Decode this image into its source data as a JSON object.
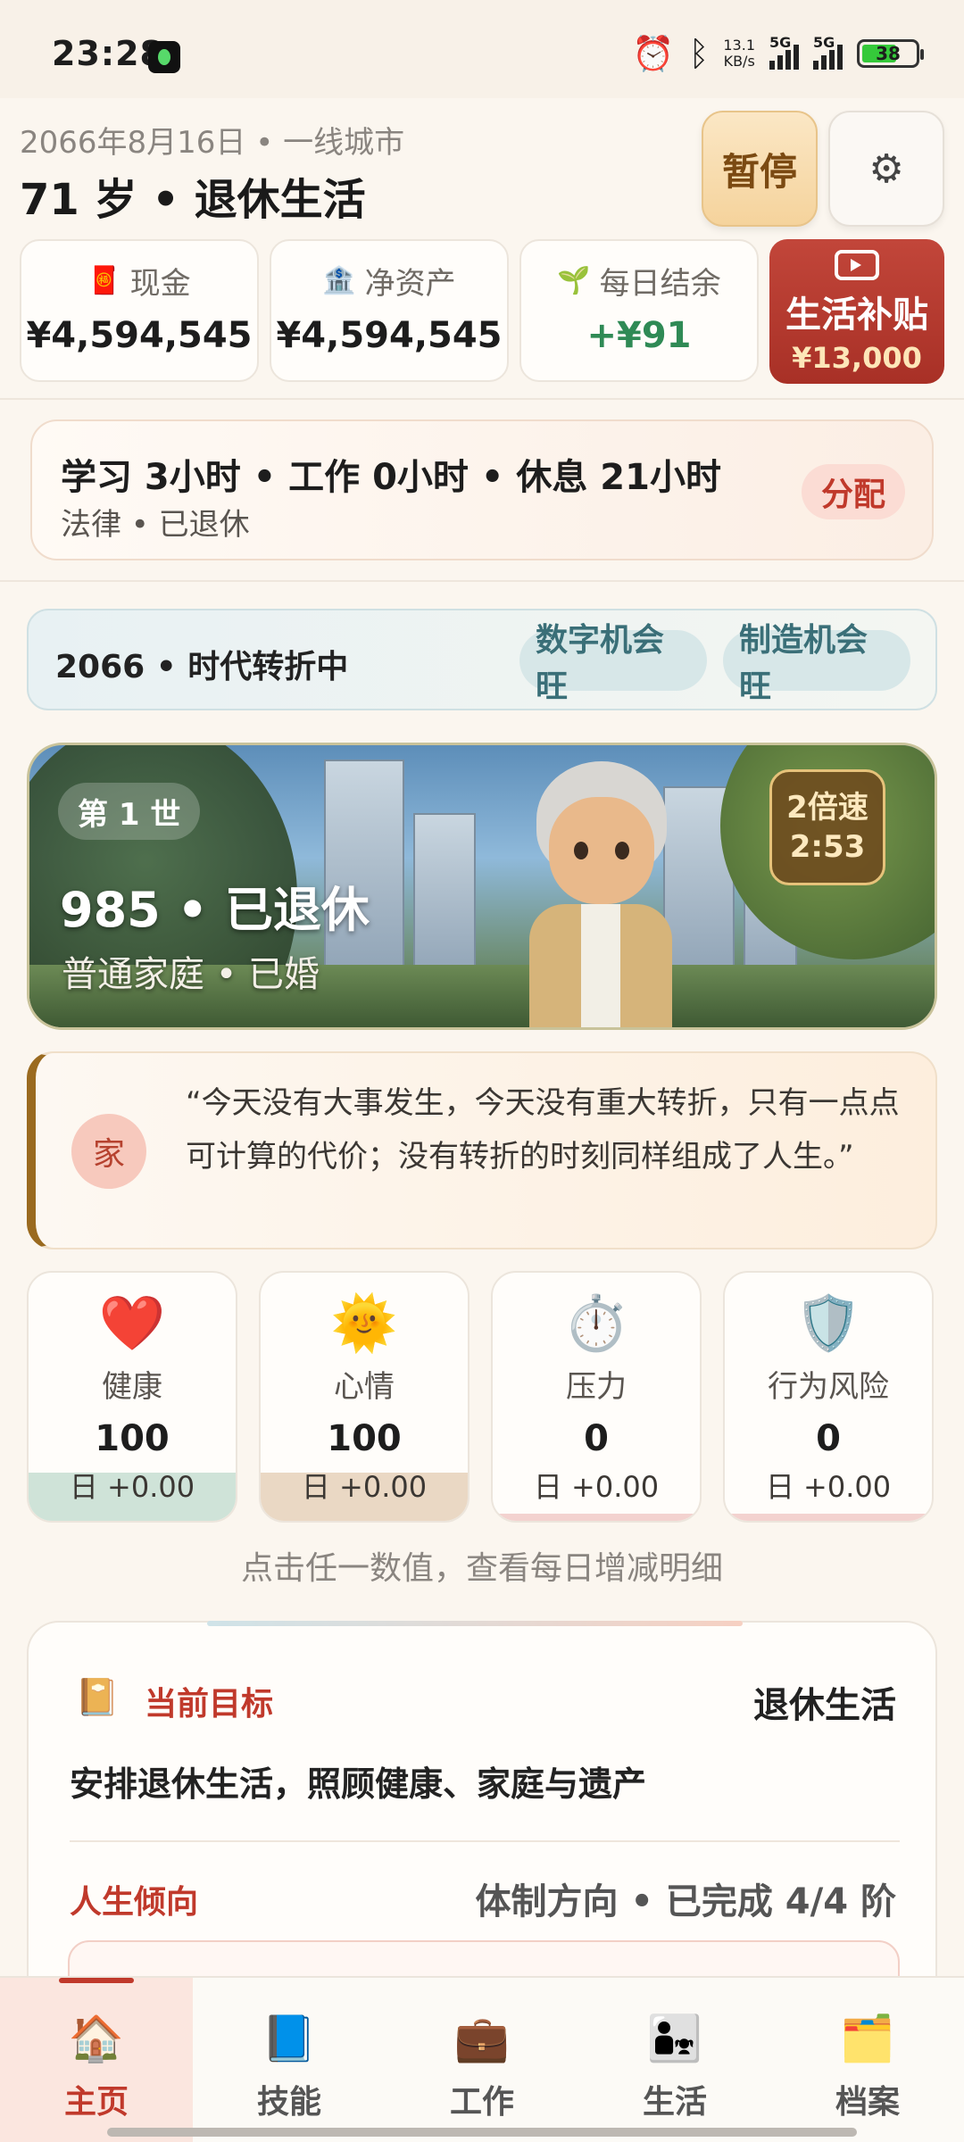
{
  "status_bar": {
    "time": "23:28",
    "net_speed_value": "13.1",
    "net_speed_unit": "KB/s",
    "sim1": "5G",
    "sim2": "5G",
    "battery": "38",
    "icons": [
      "alarm-icon",
      "bluetooth-icon"
    ]
  },
  "header": {
    "date_city": "2066年8月16日 • 一线城市",
    "age_stage": "71 岁 • 退休生活",
    "pause_label": "暂停",
    "settings_icon": "gear-icon"
  },
  "stats": [
    {
      "label": "现金",
      "value": "¥4,594,545",
      "icon": "red-envelope-icon"
    },
    {
      "label": "净资产",
      "value": "¥4,594,545",
      "icon": "building-icon"
    },
    {
      "label": "每日结余",
      "value": "+¥91",
      "icon": "sprout-icon",
      "color": "#2f8a55"
    }
  ],
  "subsidy": {
    "label": "生活补贴",
    "amount": "¥13,000",
    "icon": "video-icon"
  },
  "schedule": {
    "line1": "学习 3小时 • 工作 0小时 • 休息 21小时",
    "line2": "法律 • 已退休",
    "assign_label": "分配"
  },
  "era": {
    "title": "2066 • 时代转折中",
    "chips": [
      "数字机会旺",
      "制造机会旺"
    ]
  },
  "hero": {
    "generation": "第 1 世",
    "title": "985 • 已退休",
    "subtitle": "普通家庭 • 已婚",
    "speed_label": "2倍速",
    "speed_timer": "2:53"
  },
  "quote": {
    "badge": "家",
    "text": "“今天没有大事发生，今天没有重大转折，只有一点点可计算的代价；没有转折的时刻同样组成了人生。”"
  },
  "metrics": [
    {
      "label": "健康",
      "value": "100",
      "delta": "日 +0.00",
      "icon": "heart-icon",
      "level": 1.0,
      "color": "#cfe3d8"
    },
    {
      "label": "心情",
      "value": "100",
      "delta": "日 +0.00",
      "icon": "sun-icon",
      "level": 1.0,
      "color": "#ead8c4"
    },
    {
      "label": "压力",
      "value": "0",
      "delta": "日 +0.00",
      "icon": "stopwatch-icon",
      "level": 0.0,
      "color": "#f3d2cf"
    },
    {
      "label": "行为风险",
      "value": "0",
      "delta": "日 +0.00",
      "icon": "warning-shield-icon",
      "level": 0.0,
      "color": "#f3d2cf"
    }
  ],
  "metrics_hint": "点击任一数值，查看每日增减明细",
  "goal": {
    "label": "当前目标",
    "value": "退休生活",
    "description": "安排退休生活，照顾健康、家庭与遗产",
    "tendency_label": "人生倾向",
    "tendency_value": "体制方向 • 已完成 4/4 阶"
  },
  "nav": [
    {
      "label": "主页",
      "icon": "home-icon",
      "active": true
    },
    {
      "label": "技能",
      "icon": "skill-book-icon",
      "active": false
    },
    {
      "label": "工作",
      "icon": "briefcase-icon",
      "active": false
    },
    {
      "label": "生活",
      "icon": "family-icon",
      "active": false
    },
    {
      "label": "档案",
      "icon": "archive-icon",
      "active": false
    }
  ]
}
